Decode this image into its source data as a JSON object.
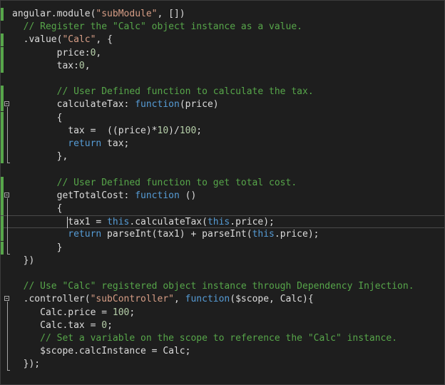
{
  "editor": {
    "lines": [
      [
        {
          "t": "text",
          "v": "angular.module("
        },
        {
          "t": "str",
          "v": "\"subModule\""
        },
        {
          "t": "text",
          "v": ", [])"
        }
      ],
      [
        {
          "t": "com",
          "v": "  // Register the \"Calc\" object instance as a value."
        }
      ],
      [
        {
          "t": "text",
          "v": "  .value("
        },
        {
          "t": "str",
          "v": "\"Calc\""
        },
        {
          "t": "text",
          "v": ", {"
        }
      ],
      [
        {
          "t": "text",
          "v": "        price:"
        },
        {
          "t": "num",
          "v": "0"
        },
        {
          "t": "text",
          "v": ","
        }
      ],
      [
        {
          "t": "text",
          "v": "        tax:"
        },
        {
          "t": "num",
          "v": "0"
        },
        {
          "t": "text",
          "v": ","
        }
      ],
      [],
      [
        {
          "t": "com",
          "v": "        // User Defined function to calculate the tax."
        }
      ],
      [
        {
          "t": "text",
          "v": "        calculateTax: "
        },
        {
          "t": "kw",
          "v": "function"
        },
        {
          "t": "text",
          "v": "(price)"
        }
      ],
      [
        {
          "t": "text",
          "v": "        {"
        }
      ],
      [
        {
          "t": "text",
          "v": "          tax =  ((price)*"
        },
        {
          "t": "num",
          "v": "10"
        },
        {
          "t": "text",
          "v": ")/"
        },
        {
          "t": "num",
          "v": "100"
        },
        {
          "t": "text",
          "v": ";"
        }
      ],
      [
        {
          "t": "kw",
          "v": "          return"
        },
        {
          "t": "text",
          "v": " tax;"
        }
      ],
      [
        {
          "t": "text",
          "v": "        },"
        }
      ],
      [],
      [
        {
          "t": "com",
          "v": "        // User Defined function to get total cost."
        }
      ],
      [
        {
          "t": "text",
          "v": "        getTotalCost: "
        },
        {
          "t": "kw",
          "v": "function"
        },
        {
          "t": "text",
          "v": " ()"
        }
      ],
      [
        {
          "t": "text",
          "v": "        {"
        }
      ],
      [
        {
          "t": "text",
          "v": "          tax1 = "
        },
        {
          "t": "kw",
          "v": "this"
        },
        {
          "t": "text",
          "v": ".calculateTax("
        },
        {
          "t": "kw",
          "v": "this"
        },
        {
          "t": "text",
          "v": ".price);"
        }
      ],
      [
        {
          "t": "kw",
          "v": "          return"
        },
        {
          "t": "text",
          "v": " parseInt(tax1) + parseInt("
        },
        {
          "t": "kw",
          "v": "this"
        },
        {
          "t": "text",
          "v": ".price);"
        }
      ],
      [
        {
          "t": "text",
          "v": "        }"
        }
      ],
      [
        {
          "t": "text",
          "v": "  })"
        }
      ],
      [],
      [
        {
          "t": "com",
          "v": "  // Use \"Calc\" registered object instance through Dependency Injection."
        }
      ],
      [
        {
          "t": "text",
          "v": "  .controller("
        },
        {
          "t": "str",
          "v": "\"subController\""
        },
        {
          "t": "text",
          "v": ", "
        },
        {
          "t": "kw",
          "v": "function"
        },
        {
          "t": "text",
          "v": "($scope, Calc){"
        }
      ],
      [
        {
          "t": "text",
          "v": "     Calc.price = "
        },
        {
          "t": "num",
          "v": "100"
        },
        {
          "t": "text",
          "v": ";"
        }
      ],
      [
        {
          "t": "text",
          "v": "     Calc.tax = "
        },
        {
          "t": "num",
          "v": "0"
        },
        {
          "t": "text",
          "v": ";"
        }
      ],
      [
        {
          "t": "com",
          "v": "     // Set a variable on the scope to reference the \"Calc\" instance."
        }
      ],
      [
        {
          "t": "text",
          "v": "     $scope.calcInstance = Calc;"
        }
      ],
      [
        {
          "t": "text",
          "v": "  });"
        }
      ]
    ],
    "current_line": 16,
    "changed_lines": [
      0,
      2,
      3,
      4,
      6,
      7,
      8,
      9,
      10,
      11,
      13,
      14,
      15,
      16,
      17,
      18
    ],
    "fold_lines": [
      7,
      14,
      22
    ],
    "colors": {
      "background": "#1e1e1e",
      "text": "#dcdcdc",
      "string": "#d69d85",
      "comment": "#57a64a",
      "keyword": "#569cd6",
      "number": "#b5cea8",
      "change_bar": "#57a64a"
    }
  }
}
